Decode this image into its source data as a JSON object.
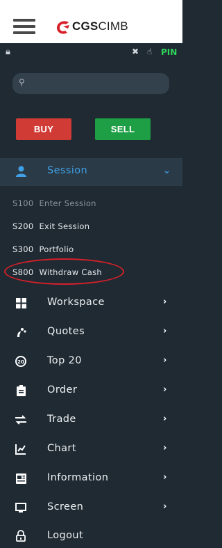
{
  "header": {
    "logo_bold": "CGS",
    "logo_light": "CIMB",
    "hamburger_icon": "hamburger-menu-icon"
  },
  "status": {
    "lock_icon": "lock-icon",
    "controls_icons": [
      "close-x-icon",
      "hand-icon"
    ],
    "pin_label": "PIN"
  },
  "search": {
    "placeholder": ""
  },
  "actions": {
    "buy_label": "BUY",
    "sell_label": "SELL"
  },
  "menu": {
    "session": {
      "label": "Session",
      "expanded": true
    },
    "session_items": [
      {
        "code": "S100",
        "label": "Enter Session",
        "enabled": false
      },
      {
        "code": "S200",
        "label": "Exit Session",
        "enabled": true
      },
      {
        "code": "S300",
        "label": "Portfolio",
        "enabled": true
      },
      {
        "code": "S800",
        "label": "Withdraw Cash",
        "enabled": true
      }
    ],
    "items": [
      {
        "label": "Workspace",
        "icon": "grid-icon"
      },
      {
        "label": "Quotes",
        "icon": "quotes-icon"
      },
      {
        "label": "Top 20",
        "icon": "top20-icon"
      },
      {
        "label": "Order",
        "icon": "clipboard-icon"
      },
      {
        "label": "Trade",
        "icon": "exchange-arrows-icon"
      },
      {
        "label": "Chart",
        "icon": "line-chart-icon"
      },
      {
        "label": "Information",
        "icon": "newspaper-icon"
      },
      {
        "label": "Screen",
        "icon": "monitor-icon"
      },
      {
        "label": "Logout",
        "icon": "logout-lock-icon"
      }
    ]
  },
  "colors": {
    "sidebar_bg": "#1f2a33",
    "active_blue": "#3fa0e6",
    "buy_red": "#d13b35",
    "sell_green": "#1f9f45",
    "pin_green": "#2fd45b",
    "highlight_red": "#d8202a"
  }
}
